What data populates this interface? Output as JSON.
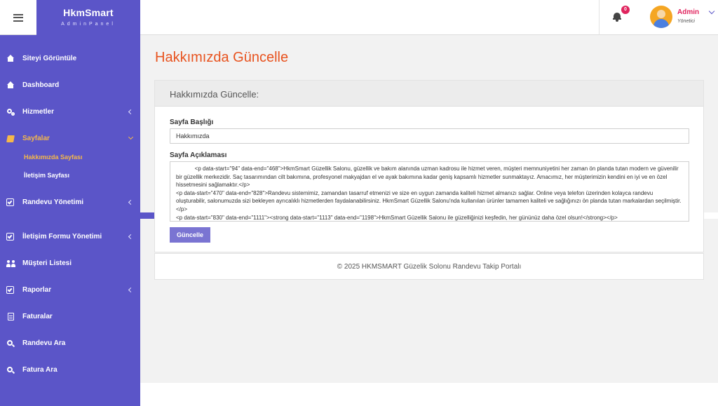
{
  "brand": {
    "title": "HkmSmart",
    "subtitle": "AdminPanel"
  },
  "header": {
    "notifications_count": "0",
    "user_name": "Admin",
    "user_role": "Yönetici"
  },
  "sidebar": {
    "items": [
      {
        "label": "Siteyi Görüntüle",
        "icon": "home-icon"
      },
      {
        "label": "Dashboard",
        "icon": "home-icon"
      },
      {
        "label": "Hizmetler",
        "icon": "gears-icon"
      },
      {
        "label": "Sayfalar",
        "icon": "book-icon"
      },
      {
        "label": "Randevu Yönetimi",
        "icon": "check-square-icon"
      },
      {
        "label": "İletişim Formu Yönetimi",
        "icon": "check-square-icon"
      },
      {
        "label": "Müşteri Listesi",
        "icon": "users-icon"
      },
      {
        "label": "Raporlar",
        "icon": "check-square-icon"
      },
      {
        "label": "Faturalar",
        "icon": "file-icon"
      },
      {
        "label": "Randevu Ara",
        "icon": "search-icon"
      },
      {
        "label": "Fatura Ara",
        "icon": "search-icon"
      }
    ],
    "sub_items": [
      {
        "label": "Hakkımızda Sayfası"
      },
      {
        "label": "İletişim Sayfası"
      }
    ]
  },
  "main": {
    "page_title": "Hakkımızda Güncelle",
    "card_title": "Hakkımızda Güncelle:",
    "title_label": "Sayfa Başlığı",
    "title_value": "Hakkımızda",
    "desc_label": "Sayfa Açıklaması",
    "desc_value": "            <p data-start=\"94\" data-end=\"468\">HkmSmart Güzellik Salonu, güzellik ve bakım alanında uzman kadrosu ile hizmet veren, müşteri memnuniyetini her zaman ön planda tutan modern ve güvenilir bir güzellik merkezidir. Saç tasarımından cilt bakımına, profesyonel makyajdan el ve ayak bakımına kadar geniş kapsamlı hizmetler sunmaktayız. Amacımız, her müşterimizin kendini en iyi ve en özel hissetmesini sağlamaktır.</p>\n<p data-start=\"470\" data-end=\"828\">Randevu sistemimiz, zamandan tasarruf etmenizi ve size en uygun zamanda kaliteli hizmet almanızı sağlar. Online veya telefon üzerinden kolayca randevu oluşturabilir, salonumuzda sizi bekleyen ayrıcalıklı hizmetlerden faydalanabilirsiniz. HkmSmart Güzellik Salonu'nda kullanılan ürünler tamamen kaliteli ve sağlığınızı ön planda tutan markalardan seçilmiştir.</p>\n<p data-start=\"830\" data-end=\"1111\"><strong data-start=\"1113\" data-end=\"1198\">HkmSmart Güzellik Salonu ile güzelliğinizi keşfedin, her gününüz daha özel olsun!</strong></p>",
    "update_button": "Güncelle"
  },
  "footer": {
    "text": "© 2025 HKMSMART Güzelik Solonu Randevu Takip Portalı"
  },
  "colors": {
    "sidebar": "#5b55c8",
    "accent": "#e8531f",
    "active": "#f5b84a",
    "badge": "#e0245e"
  }
}
